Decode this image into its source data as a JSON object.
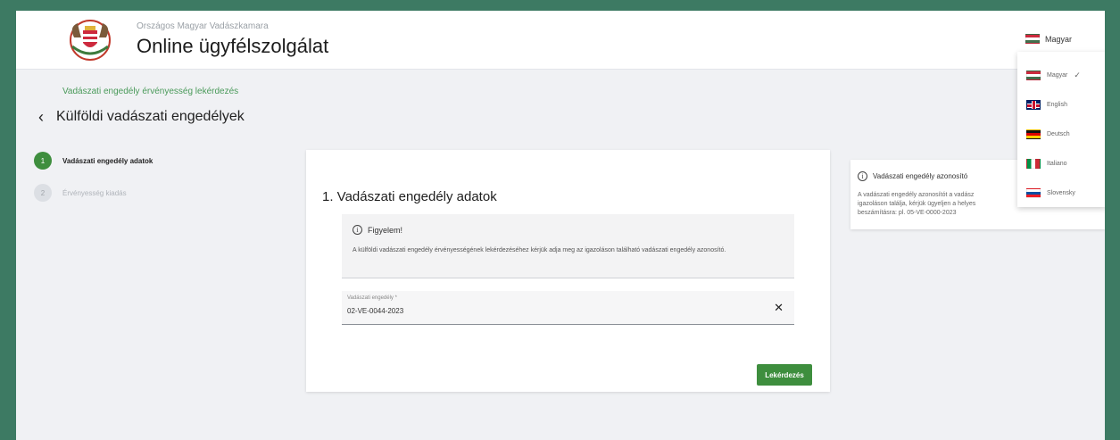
{
  "header": {
    "org_name": "Országos Magyar Vadászkamara",
    "title": "Online ügyfélszolgálat",
    "language": "Magyar"
  },
  "breadcrumb": "Vadászati engedély érvényesség lekérdezés",
  "page_title": "Külföldi vadászati engedélyek",
  "steps": [
    {
      "number": "1",
      "label": "Vadászati engedély adatok",
      "active": true
    },
    {
      "number": "2",
      "label": "Érvényesség kiadás",
      "active": false
    }
  ],
  "form": {
    "title": "1. Vadászati engedély adatok",
    "notice_title": "Figyelem!",
    "notice_text": "A külföldi vadászati engedély érvényességének lekérdezéséhez kérjük adja meg az igazoláson található vadászati engedély azonosító.",
    "field_label": "Vadászati engedély *",
    "field_value": "02-VE-0044-2023",
    "submit_label": "Lekérdezés"
  },
  "info_panel": {
    "title": "Vadászati engedély azonosító",
    "text_lines": [
      "A vadászati engedély azonosítót a vadász",
      "igazoláson találja, kérjük ügyeljen a helyes",
      "beszámításra: pl. 05-VE-0000-2023"
    ]
  },
  "language_menu": {
    "items": [
      {
        "label": "Magyar",
        "flag": "flag-hu",
        "checked": true
      },
      {
        "label": "English",
        "flag": "flag-gb",
        "checked": false
      },
      {
        "label": "Deutsch",
        "flag": "flag-de",
        "checked": false
      },
      {
        "label": "Italiano",
        "flag": "flag-it",
        "checked": false
      },
      {
        "label": "Slovensky",
        "flag": "flag-sk",
        "checked": false
      }
    ]
  },
  "colors": {
    "frame": "#3d7a63",
    "accent_green": "#3e8e3e",
    "breadcrumb_green": "#4a9a5a",
    "page_bg": "#f0f1f4"
  }
}
